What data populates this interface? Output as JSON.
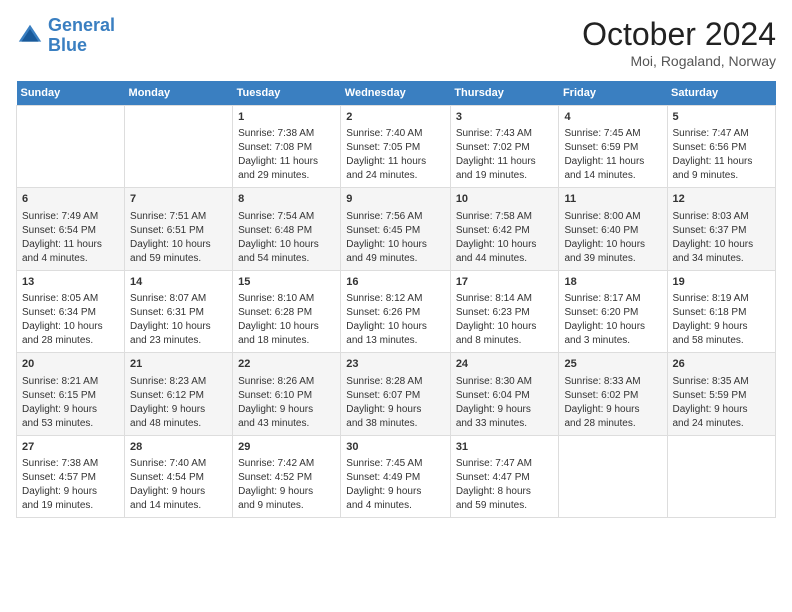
{
  "header": {
    "logo_line1": "General",
    "logo_line2": "Blue",
    "month_title": "October 2024",
    "location": "Moi, Rogaland, Norway"
  },
  "weekdays": [
    "Sunday",
    "Monday",
    "Tuesday",
    "Wednesday",
    "Thursday",
    "Friday",
    "Saturday"
  ],
  "weeks": [
    [
      {
        "day": "",
        "lines": []
      },
      {
        "day": "",
        "lines": []
      },
      {
        "day": "1",
        "lines": [
          "Sunrise: 7:38 AM",
          "Sunset: 7:08 PM",
          "Daylight: 11 hours",
          "and 29 minutes."
        ]
      },
      {
        "day": "2",
        "lines": [
          "Sunrise: 7:40 AM",
          "Sunset: 7:05 PM",
          "Daylight: 11 hours",
          "and 24 minutes."
        ]
      },
      {
        "day": "3",
        "lines": [
          "Sunrise: 7:43 AM",
          "Sunset: 7:02 PM",
          "Daylight: 11 hours",
          "and 19 minutes."
        ]
      },
      {
        "day": "4",
        "lines": [
          "Sunrise: 7:45 AM",
          "Sunset: 6:59 PM",
          "Daylight: 11 hours",
          "and 14 minutes."
        ]
      },
      {
        "day": "5",
        "lines": [
          "Sunrise: 7:47 AM",
          "Sunset: 6:56 PM",
          "Daylight: 11 hours",
          "and 9 minutes."
        ]
      }
    ],
    [
      {
        "day": "6",
        "lines": [
          "Sunrise: 7:49 AM",
          "Sunset: 6:54 PM",
          "Daylight: 11 hours",
          "and 4 minutes."
        ]
      },
      {
        "day": "7",
        "lines": [
          "Sunrise: 7:51 AM",
          "Sunset: 6:51 PM",
          "Daylight: 10 hours",
          "and 59 minutes."
        ]
      },
      {
        "day": "8",
        "lines": [
          "Sunrise: 7:54 AM",
          "Sunset: 6:48 PM",
          "Daylight: 10 hours",
          "and 54 minutes."
        ]
      },
      {
        "day": "9",
        "lines": [
          "Sunrise: 7:56 AM",
          "Sunset: 6:45 PM",
          "Daylight: 10 hours",
          "and 49 minutes."
        ]
      },
      {
        "day": "10",
        "lines": [
          "Sunrise: 7:58 AM",
          "Sunset: 6:42 PM",
          "Daylight: 10 hours",
          "and 44 minutes."
        ]
      },
      {
        "day": "11",
        "lines": [
          "Sunrise: 8:00 AM",
          "Sunset: 6:40 PM",
          "Daylight: 10 hours",
          "and 39 minutes."
        ]
      },
      {
        "day": "12",
        "lines": [
          "Sunrise: 8:03 AM",
          "Sunset: 6:37 PM",
          "Daylight: 10 hours",
          "and 34 minutes."
        ]
      }
    ],
    [
      {
        "day": "13",
        "lines": [
          "Sunrise: 8:05 AM",
          "Sunset: 6:34 PM",
          "Daylight: 10 hours",
          "and 28 minutes."
        ]
      },
      {
        "day": "14",
        "lines": [
          "Sunrise: 8:07 AM",
          "Sunset: 6:31 PM",
          "Daylight: 10 hours",
          "and 23 minutes."
        ]
      },
      {
        "day": "15",
        "lines": [
          "Sunrise: 8:10 AM",
          "Sunset: 6:28 PM",
          "Daylight: 10 hours",
          "and 18 minutes."
        ]
      },
      {
        "day": "16",
        "lines": [
          "Sunrise: 8:12 AM",
          "Sunset: 6:26 PM",
          "Daylight: 10 hours",
          "and 13 minutes."
        ]
      },
      {
        "day": "17",
        "lines": [
          "Sunrise: 8:14 AM",
          "Sunset: 6:23 PM",
          "Daylight: 10 hours",
          "and 8 minutes."
        ]
      },
      {
        "day": "18",
        "lines": [
          "Sunrise: 8:17 AM",
          "Sunset: 6:20 PM",
          "Daylight: 10 hours",
          "and 3 minutes."
        ]
      },
      {
        "day": "19",
        "lines": [
          "Sunrise: 8:19 AM",
          "Sunset: 6:18 PM",
          "Daylight: 9 hours",
          "and 58 minutes."
        ]
      }
    ],
    [
      {
        "day": "20",
        "lines": [
          "Sunrise: 8:21 AM",
          "Sunset: 6:15 PM",
          "Daylight: 9 hours",
          "and 53 minutes."
        ]
      },
      {
        "day": "21",
        "lines": [
          "Sunrise: 8:23 AM",
          "Sunset: 6:12 PM",
          "Daylight: 9 hours",
          "and 48 minutes."
        ]
      },
      {
        "day": "22",
        "lines": [
          "Sunrise: 8:26 AM",
          "Sunset: 6:10 PM",
          "Daylight: 9 hours",
          "and 43 minutes."
        ]
      },
      {
        "day": "23",
        "lines": [
          "Sunrise: 8:28 AM",
          "Sunset: 6:07 PM",
          "Daylight: 9 hours",
          "and 38 minutes."
        ]
      },
      {
        "day": "24",
        "lines": [
          "Sunrise: 8:30 AM",
          "Sunset: 6:04 PM",
          "Daylight: 9 hours",
          "and 33 minutes."
        ]
      },
      {
        "day": "25",
        "lines": [
          "Sunrise: 8:33 AM",
          "Sunset: 6:02 PM",
          "Daylight: 9 hours",
          "and 28 minutes."
        ]
      },
      {
        "day": "26",
        "lines": [
          "Sunrise: 8:35 AM",
          "Sunset: 5:59 PM",
          "Daylight: 9 hours",
          "and 24 minutes."
        ]
      }
    ],
    [
      {
        "day": "27",
        "lines": [
          "Sunrise: 7:38 AM",
          "Sunset: 4:57 PM",
          "Daylight: 9 hours",
          "and 19 minutes."
        ]
      },
      {
        "day": "28",
        "lines": [
          "Sunrise: 7:40 AM",
          "Sunset: 4:54 PM",
          "Daylight: 9 hours",
          "and 14 minutes."
        ]
      },
      {
        "day": "29",
        "lines": [
          "Sunrise: 7:42 AM",
          "Sunset: 4:52 PM",
          "Daylight: 9 hours",
          "and 9 minutes."
        ]
      },
      {
        "day": "30",
        "lines": [
          "Sunrise: 7:45 AM",
          "Sunset: 4:49 PM",
          "Daylight: 9 hours",
          "and 4 minutes."
        ]
      },
      {
        "day": "31",
        "lines": [
          "Sunrise: 7:47 AM",
          "Sunset: 4:47 PM",
          "Daylight: 8 hours",
          "and 59 minutes."
        ]
      },
      {
        "day": "",
        "lines": []
      },
      {
        "day": "",
        "lines": []
      }
    ]
  ]
}
